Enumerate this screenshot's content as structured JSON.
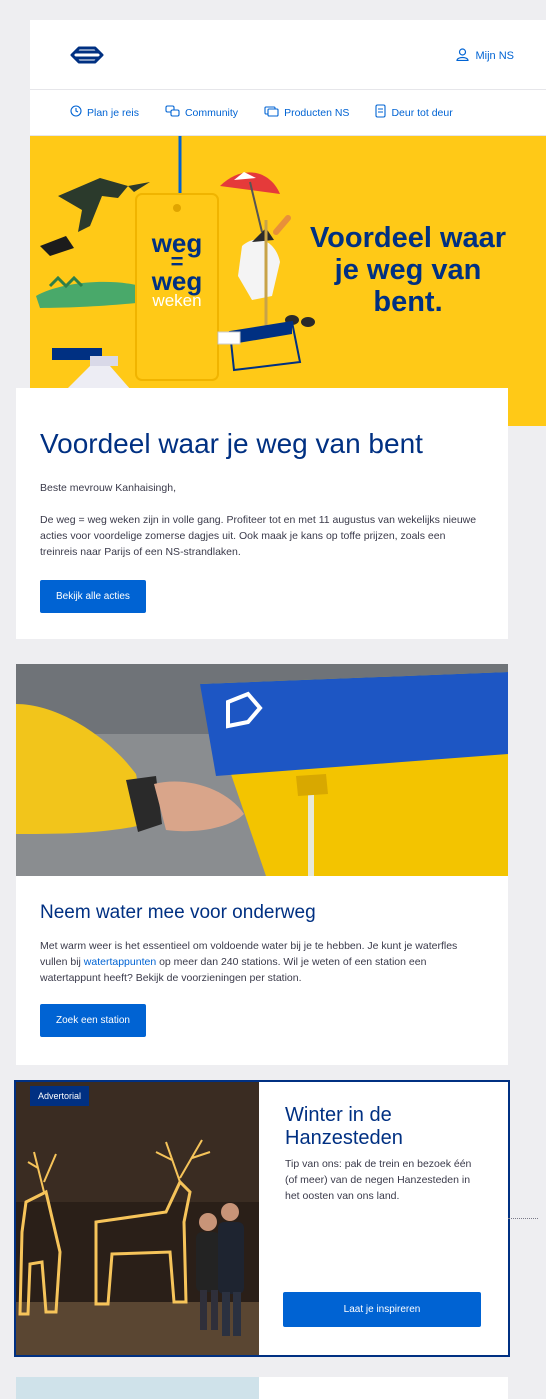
{
  "header": {
    "account_label": "Mijn NS"
  },
  "nav": {
    "items": [
      {
        "label": "Plan je reis",
        "icon": "clock-icon"
      },
      {
        "label": "Community",
        "icon": "chat-icon"
      },
      {
        "label": "Producten NS",
        "icon": "ticket-icon"
      },
      {
        "label": "Deur tot deur",
        "icon": "door-icon"
      }
    ]
  },
  "hero": {
    "tag_line1": "weg",
    "tag_line2": "=",
    "tag_line3": "weg",
    "tag_line4": "weken",
    "title": "Voordeel waar je weg van bent."
  },
  "intro": {
    "heading": "Voordeel waar je weg van bent",
    "greeting": "Beste mevrouw Kanhaisingh,",
    "body": "De weg = weg weken zijn in volle gang. Profiteer tot en met 11 augustus van wekelijks nieuwe acties voor voordelige zomerse dagjes uit. Ook maak je kans op toffe prijzen, zoals een treinreis naar Parijs of een NS-strandlaken.",
    "button": "Bekijk alle acties"
  },
  "water": {
    "heading": "Neem water mee voor onderweg",
    "body_before": "Met warm weer is het essentieel om voldoende water bij je te hebben. Je kunt je waterfles vullen bij ",
    "link": "watertappunten",
    "body_after": " op meer dan 240 stations. Wil je weten of een station een watertappunt heeft? Bekijk de voorzieningen per station.",
    "button": "Zoek een station"
  },
  "advertorial": {
    "badge": "Advertorial",
    "heading": "Winter in de Hanzesteden",
    "body": "Tip van ons: pak de trein en bezoek één (of meer) van de negen Hanzesteden in het oosten van ons land.",
    "button": "Laat je inspireren"
  },
  "colors": {
    "ns_yellow": "#ffc917",
    "ns_blue": "#003082",
    "link_blue": "#0063d3",
    "background": "#eeeef1"
  }
}
